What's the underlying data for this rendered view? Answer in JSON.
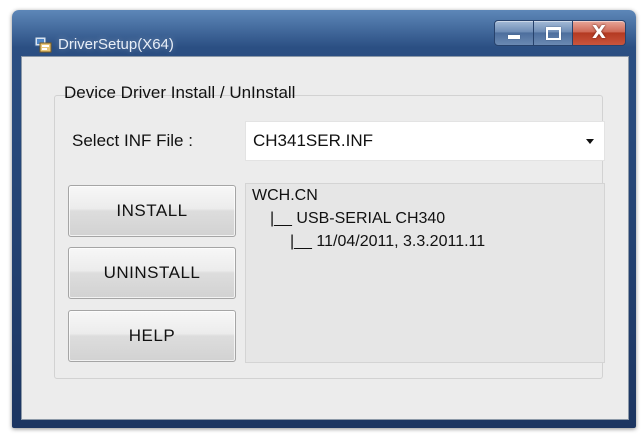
{
  "window": {
    "title": "DriverSetup(X64)",
    "app_icon": "driver-setup-icon",
    "controls": {
      "minimize_icon": "minimize-icon",
      "maximize_icon": "maximize-icon",
      "close_label": "X"
    }
  },
  "group": {
    "label": "Device Driver Install / UnInstall"
  },
  "inf_select": {
    "label": "Select INF File :",
    "value": "CH341SER.INF",
    "arrow_icon": "chevron-down-icon"
  },
  "buttons": {
    "install": "INSTALL",
    "uninstall": "UNINSTALL",
    "help": "HELP"
  },
  "info": {
    "lines": [
      "WCH.CN",
      "|__ USB-SERIAL CH340",
      "|__ 11/04/2011, 3.3.2011.11"
    ]
  },
  "colors": {
    "title_bar": "#2b4f83",
    "close_button": "#c9553d",
    "client_background": "#ececec"
  }
}
